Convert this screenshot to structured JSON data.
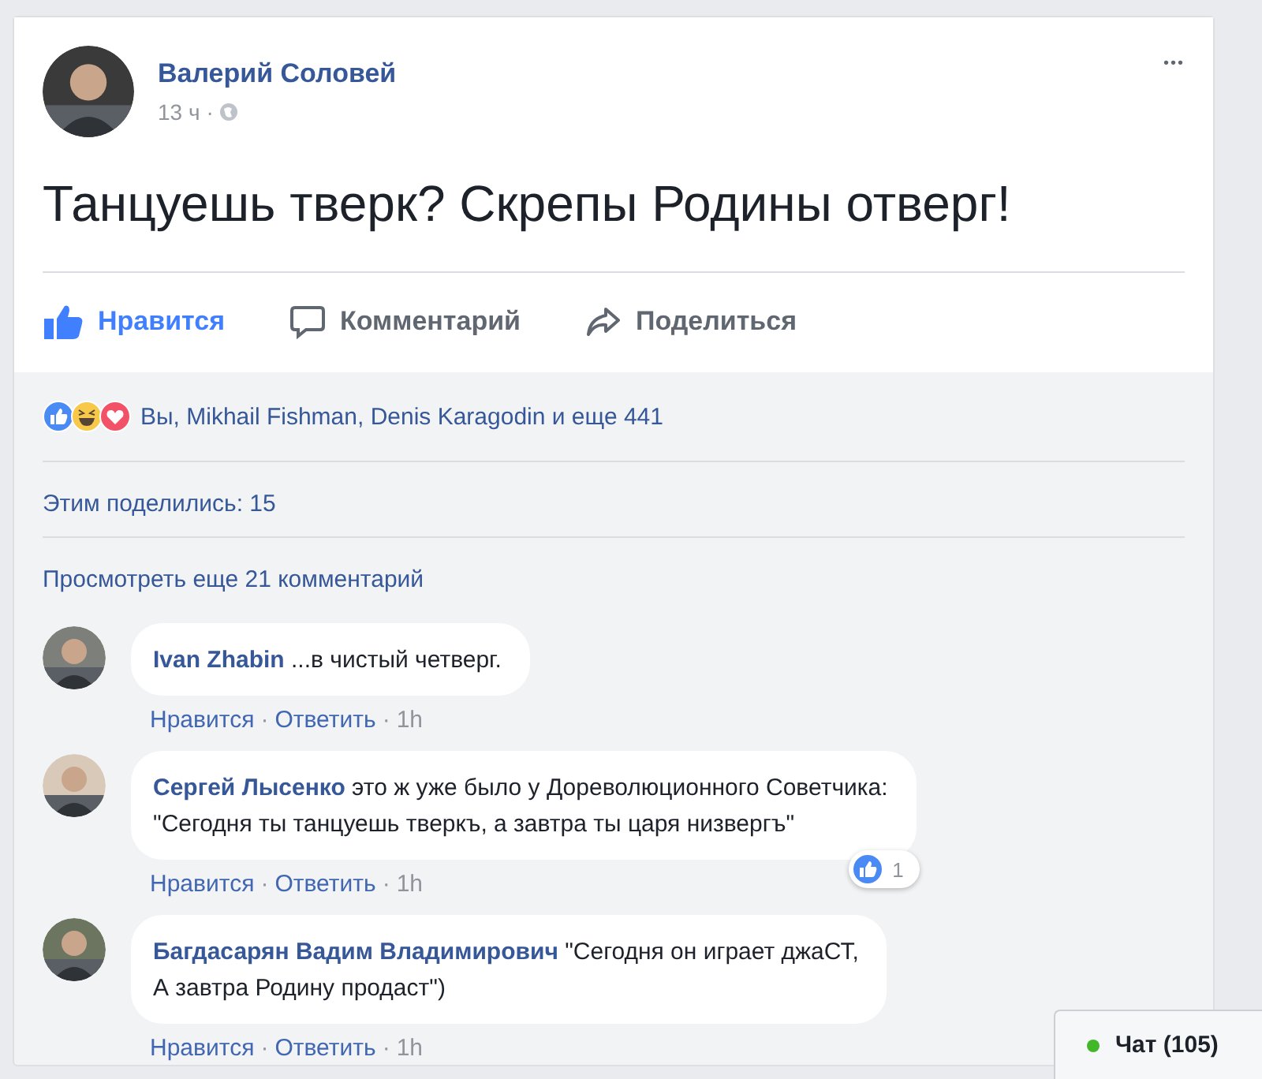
{
  "post": {
    "author": "Валерий Соловей",
    "time": "13 ч",
    "separator": "·",
    "menu": "•••",
    "text": "Танцуешь тверк? Скрепы Родины отверг!"
  },
  "actions": [
    {
      "kind": "like",
      "label": "Нравится",
      "selected": true
    },
    {
      "kind": "comment",
      "label": "Комментарий",
      "selected": false
    },
    {
      "kind": "share",
      "label": "Поделиться",
      "selected": false
    }
  ],
  "reactions": {
    "icons": [
      {
        "kind": "like"
      },
      {
        "kind": "haha"
      },
      {
        "kind": "love"
      }
    ],
    "summary": "Вы, Mikhail Fishman, Denis Karagodin и еще 441"
  },
  "shares": "Этим поделились: 15",
  "view_more": "Просмотреть еще 21 комментарий",
  "comments": [
    {
      "author": "Ivan Zhabin",
      "text": "...в чистый четверг.",
      "like": "Нравится",
      "separator": "·",
      "reply": "Ответить",
      "time": "1h"
    },
    {
      "author": "Сергей Лысенко",
      "text": "это ж уже было у Дореволюционного Советчика:\n\"Сегодня ты танцуешь тверкъ, а завтра ты царя низвергъ\"",
      "like": "Нравится",
      "separator": "·",
      "reply": "Ответить",
      "time": "1h",
      "reaction_count": "1"
    },
    {
      "author": "Багдасарян Вадим Владимирович",
      "text": "\"Сегодня он играет джаСТ,\nА завтра Родину продаст\")",
      "like": "Нравится",
      "separator": "·",
      "reply": "Ответить",
      "time": "1h"
    }
  ],
  "chat": {
    "label": "Чат (105)",
    "online": true
  }
}
